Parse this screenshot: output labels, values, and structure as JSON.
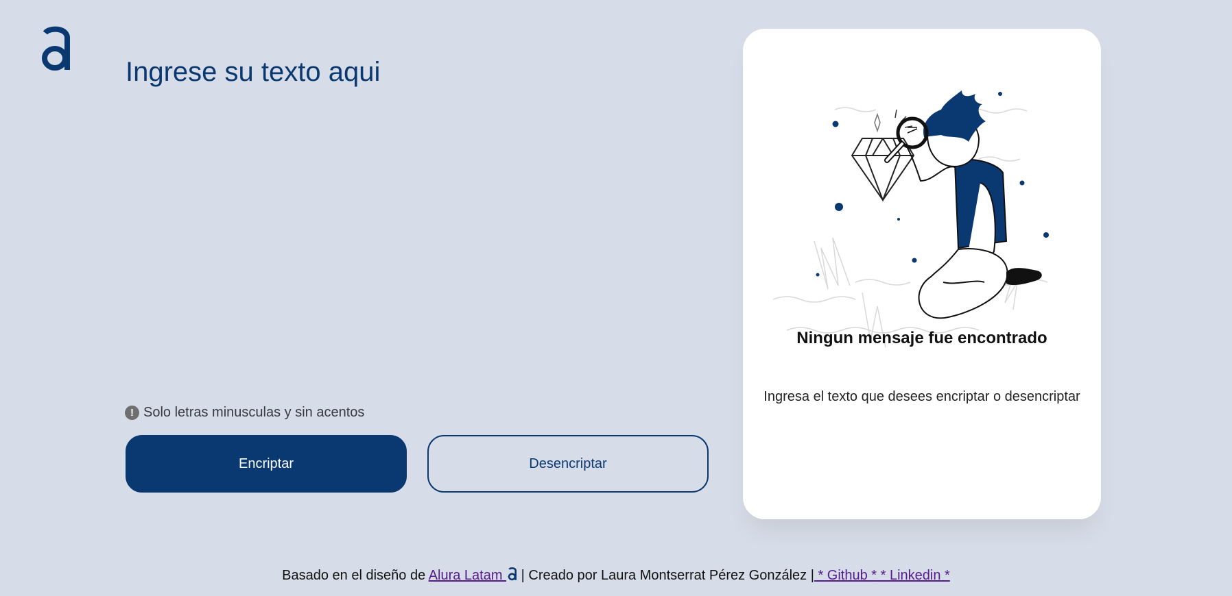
{
  "brand": {
    "logo_icon": "alura-logo-icon",
    "color": "#0a3871"
  },
  "input": {
    "placeholder": "Ingrese su texto aqui",
    "value": ""
  },
  "hint": {
    "icon": "exclamation-circle-icon",
    "text": "Solo letras minusculas y sin acentos"
  },
  "buttons": {
    "encrypt_label": "Encriptar",
    "decrypt_label": "Desencriptar"
  },
  "output": {
    "illustration": "person-with-magnifying-glass-illustration",
    "title": "Ningun mensaje fue encontrado",
    "text": "Ingresa el texto que desees encriptar o desencriptar"
  },
  "footer": {
    "prefix": "Basado en el diseño de ",
    "alura_link": "Alura Latam ",
    "credit": " | Creado por Laura Montserrat Pérez González |",
    "github_link": " * Github *",
    "linkedin_link": " * Linkedin *"
  },
  "colors": {
    "background": "#d7dde8",
    "primary": "#0a3871",
    "card": "#ffffff"
  }
}
